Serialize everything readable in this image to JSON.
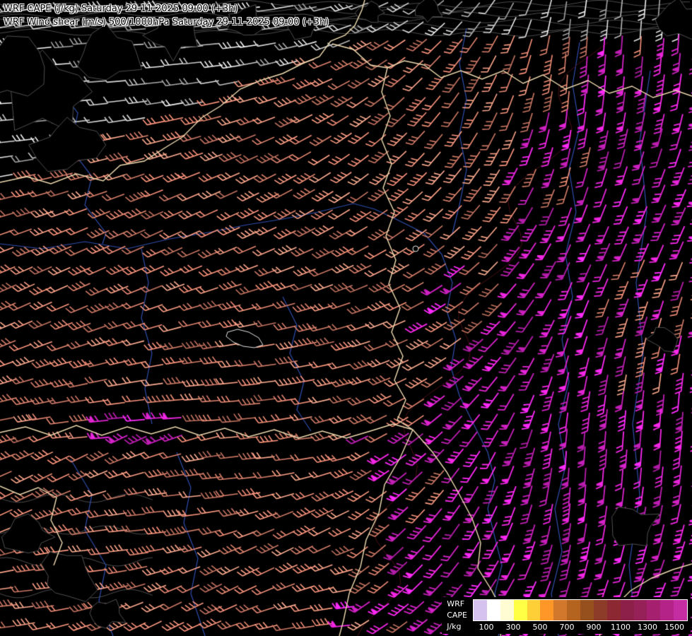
{
  "header": {
    "line1": "WRF CAPE (J/kg) Saturday 29-11-2025 09:00 (+3h)",
    "line2": "WRF Wind shear (m/s) 500/1000hPa Saturday 29-11-2025 09:00 (+3h)"
  },
  "legend": {
    "model_label": "WRF",
    "param_label": "CAPE",
    "unit_label": "J/kg",
    "tick_labels": [
      "100",
      "300",
      "500",
      "700",
      "900",
      "1100",
      "1300",
      "1500"
    ],
    "colors": [
      "#d6c2ee",
      "#ffffff",
      "#fffbd2",
      "#ffff46",
      "#ffcf38",
      "#ff9628",
      "#d2782d",
      "#b4641e",
      "#96501e",
      "#8c3c28",
      "#8c2832",
      "#8c2048",
      "#962058",
      "#a62070",
      "#b42488",
      "#c42ca2"
    ]
  },
  "map": {
    "background": "#000000",
    "border_color": "#f0dcb2",
    "river_color": "#2f4fae",
    "contour_color": "#6b6b6b",
    "cape_contour_color": "#4a1016",
    "lake_outline_color": "#e6e6e6",
    "terrain_edge_color": "#4f4f4f",
    "barb_color_low": "#c9c9c9",
    "barb_color_mid": "#ef8d77",
    "barb_color_high": "#dc23cf"
  }
}
